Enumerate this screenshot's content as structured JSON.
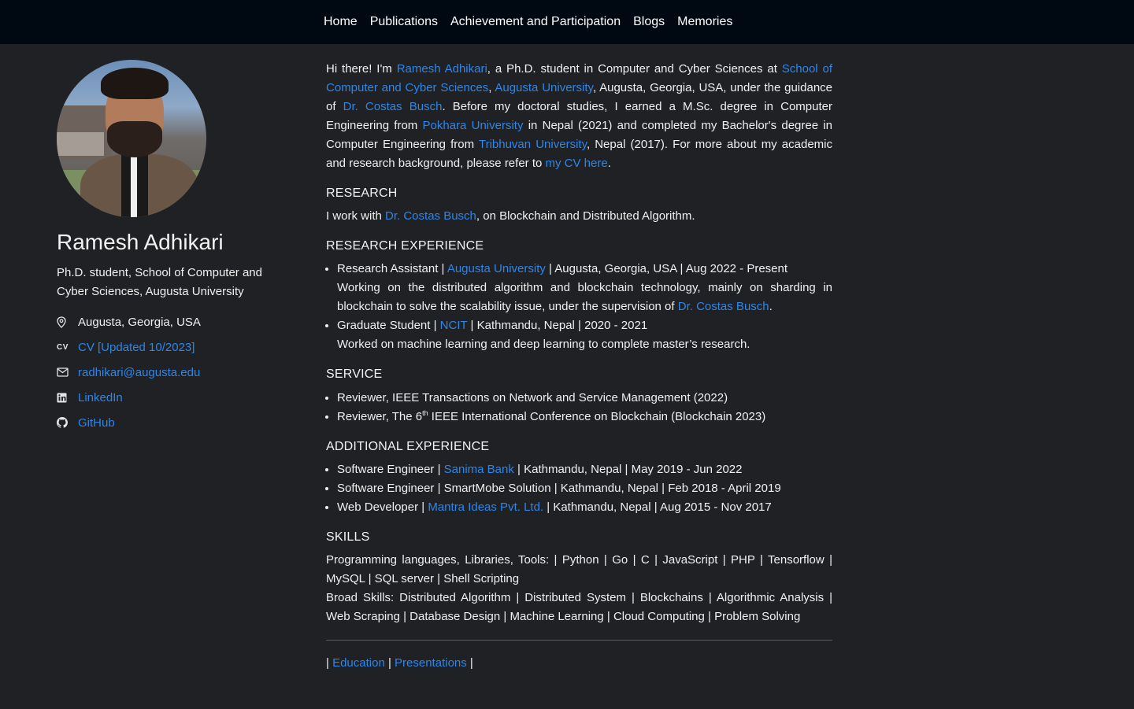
{
  "nav": {
    "items": [
      "Home",
      "Publications",
      "Achievement and Participation",
      "Blogs",
      "Memories"
    ]
  },
  "profile": {
    "name": "Ramesh Adhikari",
    "title": "Ph.D. student, School of Computer and Cyber Sciences, Augusta University",
    "location": "Augusta, Georgia, USA",
    "cv_icon": "CV",
    "cv": "CV [Updated 10/2023]",
    "email": "radhikari@augusta.edu",
    "linkedin": "LinkedIn",
    "github": "GitHub",
    "icons": [
      "location-pin-icon",
      "cv-icon",
      "envelope-icon",
      "linkedin-icon",
      "github-icon"
    ]
  },
  "intro": {
    "p1": "Hi there! I'm ",
    "name_link": "Ramesh Adhikari",
    "p2": ", a Ph.D. student in Computer and Cyber Sciences at ",
    "school_link": "School of Computer and Cyber Sciences",
    "p3": ", ",
    "univ_link": "Augusta University",
    "p4": ", Augusta, Georgia, USA, under the guidance of ",
    "advisor_link": "Dr. Costas Busch",
    "p5": ". Before my doctoral studies, I earned a M.Sc. degree in Computer Engineering from ",
    "pokhara_link": "Pokhara University",
    "p6": " in Nepal (2021) and completed my Bachelor's degree in Computer Engineering from ",
    "tu_link": "Tribhuvan University",
    "p7": ", Nepal (2017). For more about my academic and research background, please refer to ",
    "cv_link": "my CV here",
    "p8": "."
  },
  "research": {
    "heading": "RESEARCH",
    "p1": "I work with ",
    "advisor_link": "Dr. Costas Busch",
    "p2": ", on Blockchain and Distributed Algorithm."
  },
  "research_experience": {
    "heading": "RESEARCH EXPERIENCE",
    "items": [
      {
        "pre": "Research Assistant | ",
        "link": "Augusta University",
        "post": " | Augusta, Georgia, USA | Aug 2022 - Present",
        "desc_pre": "Working on the distributed algorithm and blockchain technology, mainly on sharding in blockchain to solve the scalability issue, under the supervision of ",
        "desc_link": "Dr. Costas Busch",
        "desc_post": "."
      },
      {
        "pre": "Graduate Student | ",
        "link": "NCIT",
        "post": " | Kathmandu, Nepal | 2020 - 2021",
        "desc": "Worked on machine learning and deep learning to complete master’s research."
      }
    ]
  },
  "service": {
    "heading": "SERVICE",
    "item1": "Reviewer, IEEE Transactions on Network and Service Management (2022)",
    "item2_pre": "Reviewer, The 6",
    "item2_sup": "th",
    "item2_post": " IEEE International Conference on Blockchain (Blockchain 2023)"
  },
  "additional_experience": {
    "heading": "ADDITIONAL EXPERIENCE",
    "item1_pre": "Software Engineer | ",
    "item1_link": "Sanima Bank",
    "item1_post": " | Kathmandu, Nepal | May 2019 - Jun 2022",
    "item2": "Software Engineer | SmartMobe Solution | Kathmandu, Nepal | Feb 2018 - April 2019",
    "item3_pre": "Web Developer | ",
    "item3_link": "Mantra Ideas Pvt. Ltd.",
    "item3_post": " | Kathmandu, Nepal | Aug 2015 - Nov 2017"
  },
  "skills": {
    "heading": "SKILLS",
    "programming": "Programming languages, Libraries, Tools: | Python | Go | C | JavaScript | PHP | Tensorflow | MySQL | SQL server | Shell Scripting",
    "broad": "Broad Skills: Distributed Algorithm | Distributed System | Blockchains | Algorithmic Analysis | Web Scraping | Database Design | Machine Learning | Cloud Computing | Problem Solving"
  },
  "footer": {
    "sep1": "| ",
    "education": "Education",
    "sep2": " | ",
    "presentations": "Presentations",
    "sep3": " |"
  }
}
